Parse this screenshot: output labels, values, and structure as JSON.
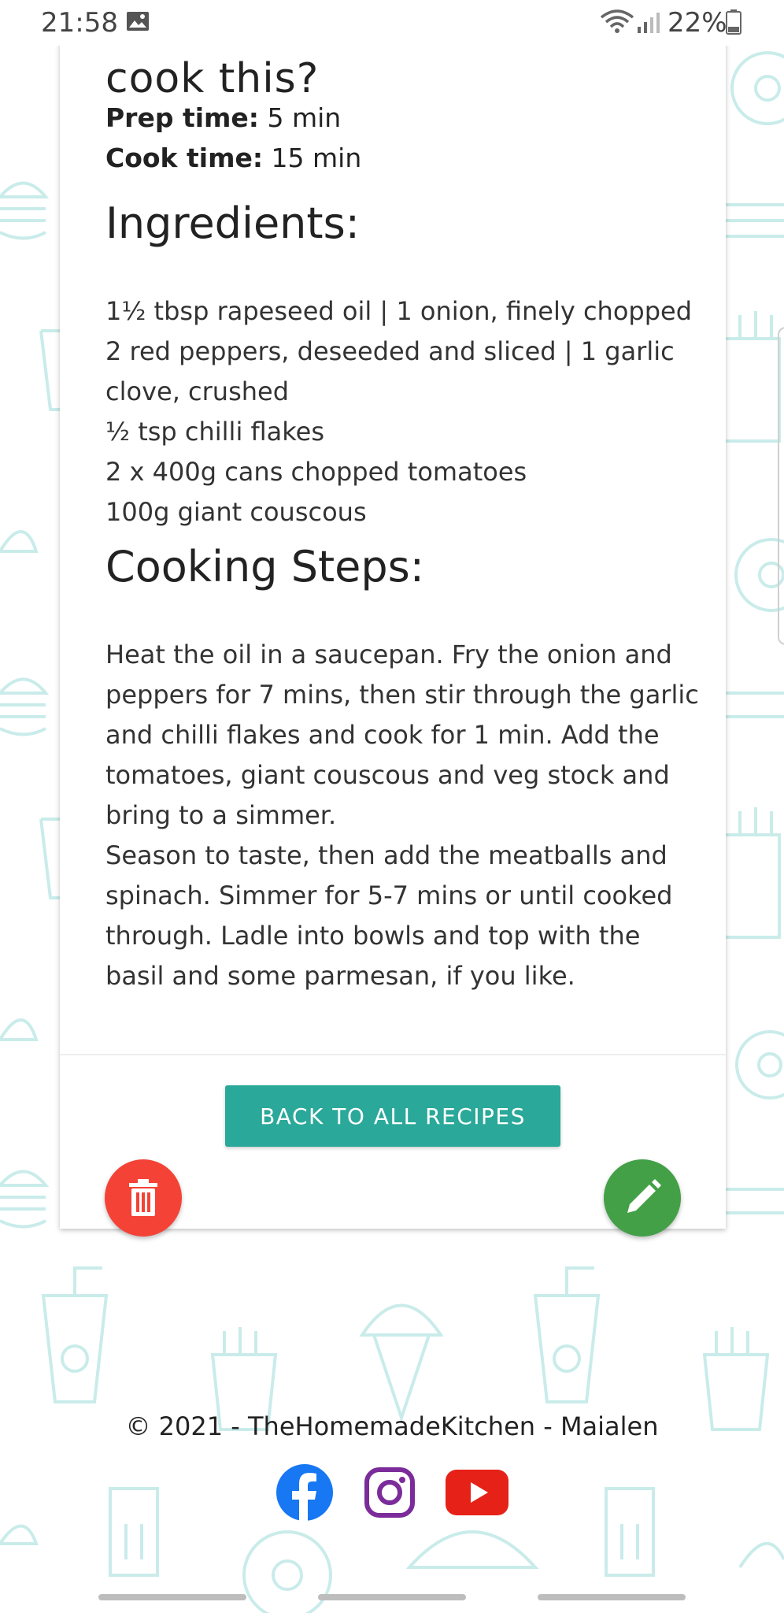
{
  "status_bar": {
    "time": "21:58",
    "battery": "22%"
  },
  "recipe": {
    "heading_partial": "cook this?",
    "prep_label": "Prep time:",
    "prep_value": " 5 min",
    "cook_label": "Cook time:",
    "cook_value": " 15 min",
    "ingredients_title": "Ingredients:",
    "ingredients": [
      "1½ tbsp rapeseed oil | 1 onion, finely chopped",
      "2 red peppers, deseeded and sliced | 1 garlic clove, crushed",
      "½ tsp chilli flakes",
      "2 x 400g cans chopped tomatoes",
      "100g giant couscous"
    ],
    "steps_title": "Cooking Steps:",
    "steps": [
      "Heat the oil in a saucepan. Fry the onion and peppers for 7 mins, then stir through the garlic and chilli flakes and cook for 1 min. Add the tomatoes, giant couscous and veg stock and bring to a simmer.",
      "Season to taste, then add the meatballs and spinach. Simmer for 5-7 mins or until cooked through. Ladle into bowls and top with the basil and some parmesan, if you like."
    ]
  },
  "actions": {
    "back_label": "BACK TO ALL RECIPES",
    "delete_icon": "trash-icon",
    "edit_icon": "pencil-icon"
  },
  "footer": {
    "copyright": "© 2021 - TheHomemadeKitchen - Maialen",
    "social": [
      "facebook-icon",
      "instagram-icon",
      "youtube-icon"
    ]
  },
  "colors": {
    "accent": "#2aa899",
    "delete": "#f44336",
    "edit": "#43a047",
    "facebook": "#1877f2",
    "instagram": "#7b2c9a",
    "youtube": "#e62117",
    "doodle": "#c9ecea"
  }
}
